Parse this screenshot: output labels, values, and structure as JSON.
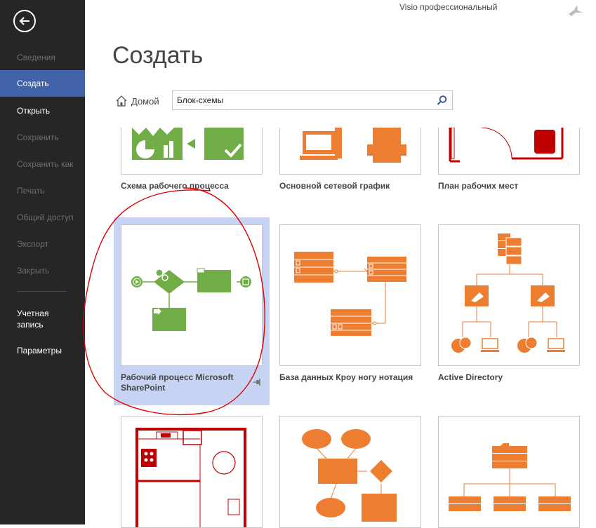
{
  "app": {
    "title": "Visio профессиональный"
  },
  "page": {
    "title": "Создать"
  },
  "sidebar": {
    "items": [
      {
        "label": "Сведения",
        "enabled": false
      },
      {
        "label": "Создать",
        "enabled": true,
        "active": true
      },
      {
        "label": "Открыть",
        "enabled": true
      },
      {
        "label": "Сохранить",
        "enabled": false
      },
      {
        "label": "Сохранить как",
        "enabled": false
      },
      {
        "label": "Печать",
        "enabled": false
      },
      {
        "label": "Общий доступ",
        "enabled": false
      },
      {
        "label": "Экспорт",
        "enabled": false
      },
      {
        "label": "Закрыть",
        "enabled": false
      }
    ],
    "account_line1": "Учетная",
    "account_line2": "запись",
    "options": "Параметры"
  },
  "search": {
    "home_label": "Домой",
    "value": "Блок-схемы"
  },
  "templates": [
    {
      "label": "Схема рабочего процесса"
    },
    {
      "label": "Основной сетевой график"
    },
    {
      "label": "План рабочих мест"
    },
    {
      "label_line1": "Рабочий процесс Microsoft",
      "label_line2": "SharePoint",
      "selected": true
    },
    {
      "label": "База данных Кроу ногу нотация"
    },
    {
      "label": "Active Directory"
    },
    {
      "label": ""
    },
    {
      "label": ""
    },
    {
      "label": ""
    }
  ],
  "colors": {
    "sidebar_bg": "#262626",
    "active_nav": "#4262a8",
    "selection": "#c6d3f2",
    "green": "#70ad47",
    "orange": "#ed7d31",
    "red": "#c00000",
    "annotation": "#e00000"
  },
  "icons": [
    "back-arrow-icon",
    "bird-icon",
    "home-icon",
    "search-icon",
    "pin-icon"
  ]
}
